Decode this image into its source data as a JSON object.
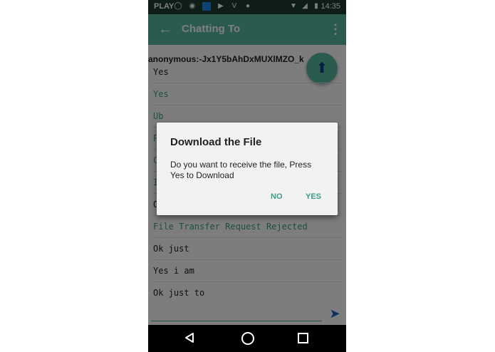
{
  "status_bar": {
    "carrier": "PLAY",
    "time": "14:35",
    "icons": [
      "bulb-icon",
      "ubuntu-icon",
      "app-icon",
      "youtube-icon",
      "vector-icon",
      "android-icon",
      "wifi-icon",
      "signal-icon",
      "battery-icon"
    ]
  },
  "app_bar": {
    "title": "Chatting To",
    "back_icon": "←",
    "menu_icon": "⋮"
  },
  "chat": {
    "peer_id": "anonymous:-Jx1Y5bAhDxMUXlMZO_k",
    "upload_icon": "⬆",
    "messages": [
      {
        "text": "Yes",
        "color": "dark"
      },
      {
        "text": "Yes",
        "color": "green"
      },
      {
        "text": "Ub",
        "color": "green"
      },
      {
        "text": "P",
        "color": "green"
      },
      {
        "text": "C",
        "color": "green"
      },
      {
        "text": "I",
        "color": "green"
      },
      {
        "text": "O",
        "color": "dark"
      },
      {
        "text": "File Transfer Request Rejected",
        "color": "green"
      },
      {
        "text": "Ok just",
        "color": "dark"
      },
      {
        "text": "Yes i am",
        "color": "dark"
      },
      {
        "text": "Ok just to",
        "color": "dark"
      }
    ],
    "send_icon": "➤"
  },
  "dialog": {
    "title": "Download the File",
    "body": "Do you want to receive the file, Press Yes to Download",
    "no_label": "NO",
    "yes_label": "YES"
  },
  "colors": {
    "accent": "#3a9d86",
    "appbar": "#56b59e",
    "statusbar": "#1f3a33"
  }
}
